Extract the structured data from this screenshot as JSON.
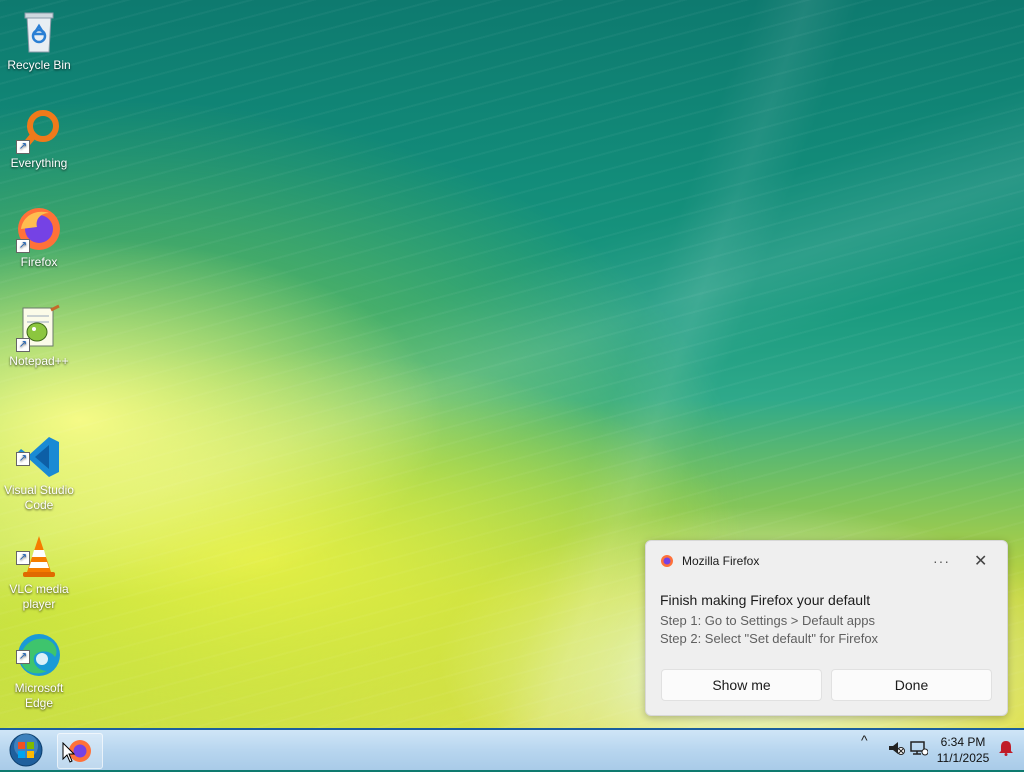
{
  "desktop": {
    "icons": [
      {
        "label": "Recycle Bin",
        "icon": "recycle-bin-icon"
      },
      {
        "label": "Everything",
        "icon": "everything-search-icon"
      },
      {
        "label": "Firefox",
        "icon": "firefox-icon"
      },
      {
        "label": "Notepad++",
        "icon": "notepad-plus-plus-icon"
      },
      {
        "label": "Visual Studio\nCode",
        "icon": "vscode-icon"
      },
      {
        "label": "VLC media\nplayer",
        "icon": "vlc-icon"
      },
      {
        "label": "Microsoft\nEdge",
        "icon": "edge-icon"
      }
    ]
  },
  "notification": {
    "app_name": "Mozilla Firefox",
    "more_label": "···",
    "close_label": "✕",
    "title": "Finish making Firefox your default",
    "line1": "Step 1: Go to Settings > Default apps",
    "line2": "Step 2: Select \"Set default\" for Firefox",
    "show_me_label": "Show me",
    "done_label": "Done"
  },
  "taskbar": {
    "start_icon": "windows-start-orb-icon",
    "pinned_app": "firefox-icon",
    "tray_chevron": "^",
    "clock_time": "6:34 PM",
    "clock_date": "11/1/2025"
  }
}
